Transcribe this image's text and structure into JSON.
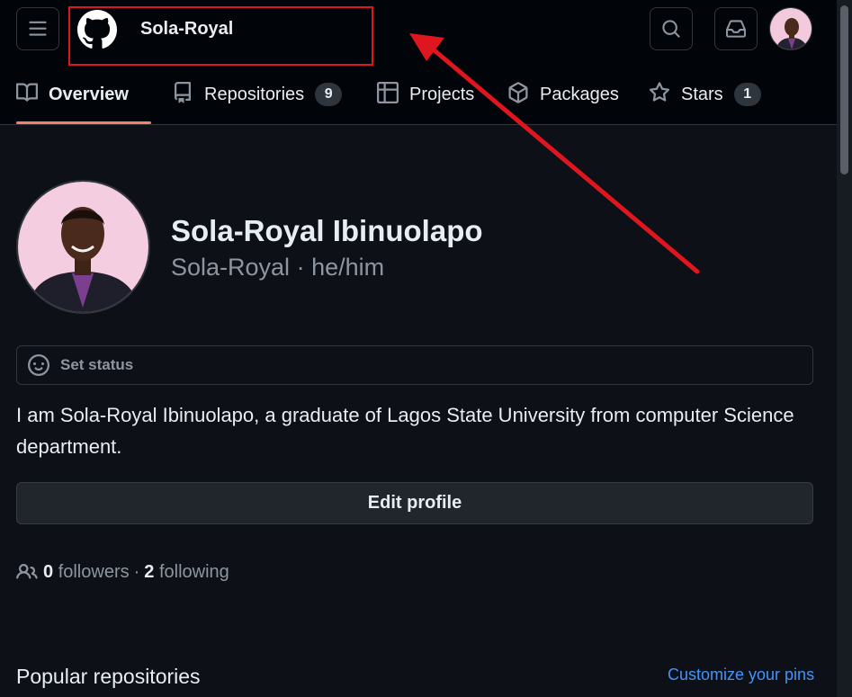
{
  "header": {
    "context_name": "Sola-Royal",
    "icons": {
      "menu": "hamburger-menu-icon",
      "logo": "github-mark-icon",
      "search": "search-icon",
      "inbox": "inbox-icon",
      "avatar": "user-avatar"
    }
  },
  "tabs": [
    {
      "label": "Overview",
      "icon": "book-icon",
      "active": true
    },
    {
      "label": "Repositories",
      "icon": "repo-icon",
      "count": "9"
    },
    {
      "label": "Projects",
      "icon": "table-icon"
    },
    {
      "label": "Packages",
      "icon": "package-icon"
    },
    {
      "label": "Stars",
      "icon": "star-icon",
      "count": "1"
    }
  ],
  "profile": {
    "full_name": "Sola-Royal Ibinuolapo",
    "login": "Sola-Royal",
    "separator": " · ",
    "pronouns": "he/him",
    "status_label": "Set status",
    "bio": "I am Sola-Royal Ibinuolapo, a graduate of Lagos State University from computer Science department.",
    "edit_button": "Edit profile",
    "followers_count": "0",
    "followers_label": "followers",
    "dot": "·",
    "following_count": "2",
    "following_label": "following"
  },
  "popular": {
    "title": "Popular repositories",
    "customize_link": "Customize your pins"
  },
  "colors": {
    "background": "#0d1117",
    "header_bg": "#010409",
    "accent_underline": "#f78166",
    "link": "#4493f8",
    "annotation_red": "#e0161f"
  }
}
